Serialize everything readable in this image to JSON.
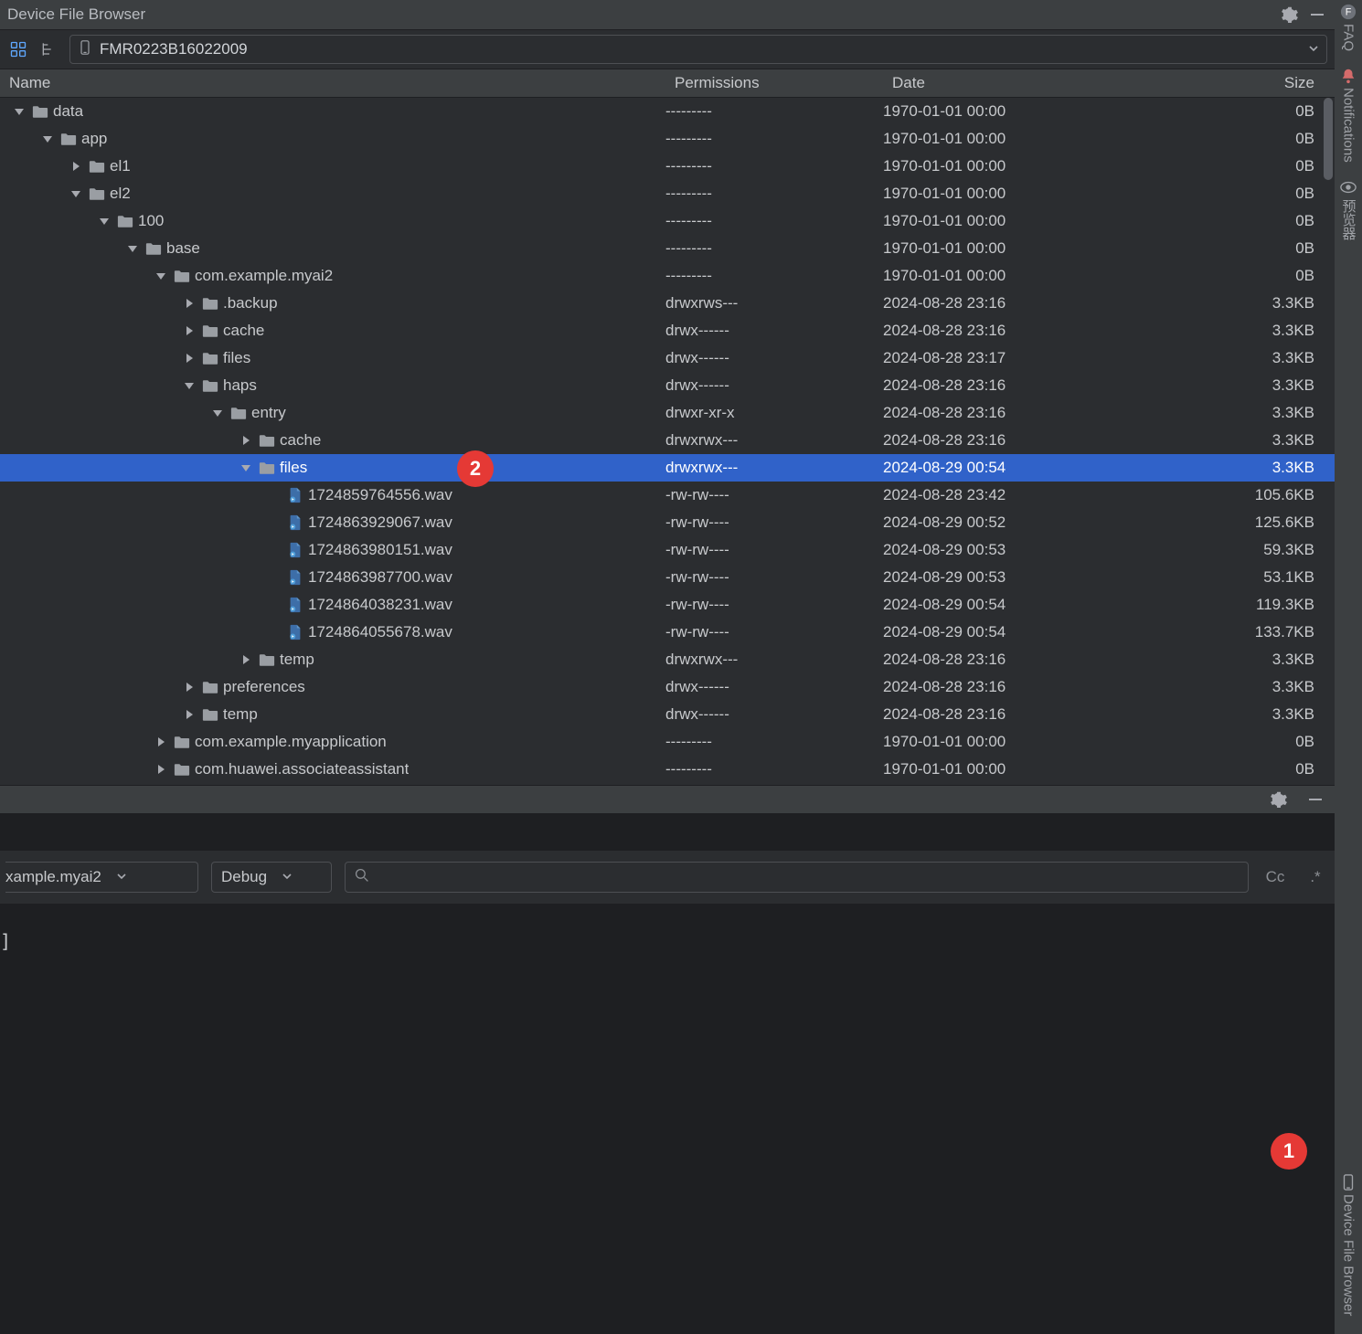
{
  "window": {
    "title": "Device File Browser"
  },
  "device": {
    "name": "FMR0223B16022009"
  },
  "columns": {
    "name": "Name",
    "permissions": "Permissions",
    "date": "Date",
    "size": "Size"
  },
  "rows": [
    {
      "depth": 0,
      "expand": "down",
      "icon": "folder",
      "name": "data",
      "perm": "---------",
      "date": "1970-01-01 00:00",
      "size": "0B"
    },
    {
      "depth": 1,
      "expand": "down",
      "icon": "folder",
      "name": "app",
      "perm": "---------",
      "date": "1970-01-01 00:00",
      "size": "0B"
    },
    {
      "depth": 2,
      "expand": "right",
      "icon": "folder",
      "name": "el1",
      "perm": "---------",
      "date": "1970-01-01 00:00",
      "size": "0B"
    },
    {
      "depth": 2,
      "expand": "down",
      "icon": "folder",
      "name": "el2",
      "perm": "---------",
      "date": "1970-01-01 00:00",
      "size": "0B"
    },
    {
      "depth": 3,
      "expand": "down",
      "icon": "folder",
      "name": "100",
      "perm": "---------",
      "date": "1970-01-01 00:00",
      "size": "0B"
    },
    {
      "depth": 4,
      "expand": "down",
      "icon": "folder",
      "name": "base",
      "perm": "---------",
      "date": "1970-01-01 00:00",
      "size": "0B"
    },
    {
      "depth": 5,
      "expand": "down",
      "icon": "folder",
      "name": "com.example.myai2",
      "perm": "---------",
      "date": "1970-01-01 00:00",
      "size": "0B"
    },
    {
      "depth": 6,
      "expand": "right",
      "icon": "folder",
      "name": ".backup",
      "perm": "drwxrws---",
      "date": "2024-08-28 23:16",
      "size": "3.3KB"
    },
    {
      "depth": 6,
      "expand": "right",
      "icon": "folder",
      "name": "cache",
      "perm": "drwx------",
      "date": "2024-08-28 23:16",
      "size": "3.3KB"
    },
    {
      "depth": 6,
      "expand": "right",
      "icon": "folder",
      "name": "files",
      "perm": "drwx------",
      "date": "2024-08-28 23:17",
      "size": "3.3KB"
    },
    {
      "depth": 6,
      "expand": "down",
      "icon": "folder",
      "name": "haps",
      "perm": "drwx------",
      "date": "2024-08-28 23:16",
      "size": "3.3KB"
    },
    {
      "depth": 7,
      "expand": "down",
      "icon": "folder",
      "name": "entry",
      "perm": "drwxr-xr-x",
      "date": "2024-08-28 23:16",
      "size": "3.3KB"
    },
    {
      "depth": 8,
      "expand": "right",
      "icon": "folder",
      "name": "cache",
      "perm": "drwxrwx---",
      "date": "2024-08-28 23:16",
      "size": "3.3KB"
    },
    {
      "depth": 8,
      "expand": "down",
      "icon": "folder",
      "name": "files",
      "perm": "drwxrwx---",
      "date": "2024-08-29 00:54",
      "size": "3.3KB",
      "selected": true
    },
    {
      "depth": 9,
      "expand": "none",
      "icon": "file",
      "name": "1724859764556.wav",
      "perm": "-rw-rw----",
      "date": "2024-08-28 23:42",
      "size": "105.6KB"
    },
    {
      "depth": 9,
      "expand": "none",
      "icon": "file",
      "name": "1724863929067.wav",
      "perm": "-rw-rw----",
      "date": "2024-08-29 00:52",
      "size": "125.6KB"
    },
    {
      "depth": 9,
      "expand": "none",
      "icon": "file",
      "name": "1724863980151.wav",
      "perm": "-rw-rw----",
      "date": "2024-08-29 00:53",
      "size": "59.3KB"
    },
    {
      "depth": 9,
      "expand": "none",
      "icon": "file",
      "name": "1724863987700.wav",
      "perm": "-rw-rw----",
      "date": "2024-08-29 00:53",
      "size": "53.1KB"
    },
    {
      "depth": 9,
      "expand": "none",
      "icon": "file",
      "name": "1724864038231.wav",
      "perm": "-rw-rw----",
      "date": "2024-08-29 00:54",
      "size": "119.3KB"
    },
    {
      "depth": 9,
      "expand": "none",
      "icon": "file",
      "name": "1724864055678.wav",
      "perm": "-rw-rw----",
      "date": "2024-08-29 00:54",
      "size": "133.7KB"
    },
    {
      "depth": 8,
      "expand": "right",
      "icon": "folder",
      "name": "temp",
      "perm": "drwxrwx---",
      "date": "2024-08-28 23:16",
      "size": "3.3KB"
    },
    {
      "depth": 6,
      "expand": "right",
      "icon": "folder",
      "name": "preferences",
      "perm": "drwx------",
      "date": "2024-08-28 23:16",
      "size": "3.3KB"
    },
    {
      "depth": 6,
      "expand": "right",
      "icon": "folder",
      "name": "temp",
      "perm": "drwx------",
      "date": "2024-08-28 23:16",
      "size": "3.3KB"
    },
    {
      "depth": 5,
      "expand": "right",
      "icon": "folder",
      "name": "com.example.myapplication",
      "perm": "---------",
      "date": "1970-01-01 00:00",
      "size": "0B"
    },
    {
      "depth": 5,
      "expand": "right",
      "icon": "folder",
      "name": "com.huawei.associateassistant",
      "perm": "---------",
      "date": "1970-01-01 00:00",
      "size": "0B"
    }
  ],
  "log_toolbar": {
    "app_combo": "xample.myai2",
    "level_combo": "Debug",
    "search_placeholder": "",
    "opt1": "Cc",
    "opt2": ".*"
  },
  "log_body": {
    "line1": "]"
  },
  "right_sidebar": {
    "faq_icon_letter": "F",
    "faq": "FAQ",
    "notifications": "Notifications",
    "preview": "预览器",
    "device_file_browser": "Device File Browser"
  },
  "badges": {
    "b1": "1",
    "b2": "2"
  }
}
